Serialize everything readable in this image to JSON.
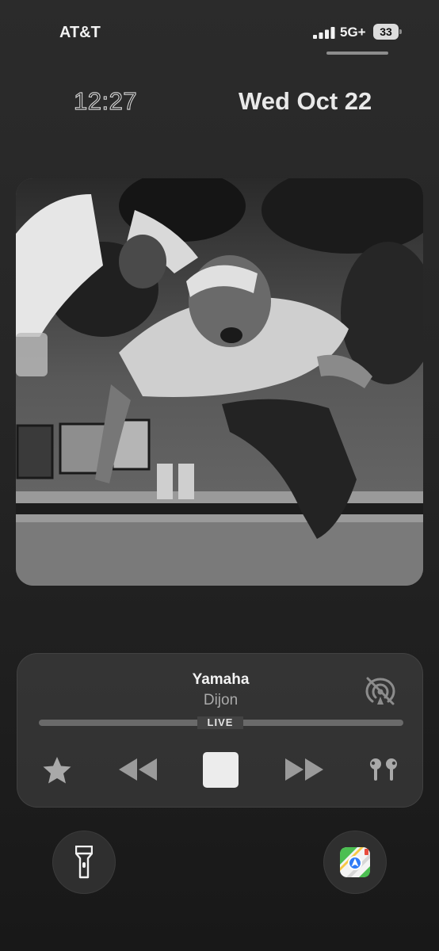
{
  "status_bar": {
    "carrier": "AT&T",
    "network": "5G+",
    "battery_level": "33",
    "icons": [
      "signal-bars-icon",
      "battery-icon"
    ]
  },
  "lock_screen": {
    "time": "12:27",
    "date": "Wed Oct 22"
  },
  "now_playing": {
    "artwork": "album-artwork-bw-party-photo",
    "title": "Yamaha",
    "artist": "Dijon",
    "progress_label": "LIVE",
    "controls": [
      "star-icon",
      "rewind-icon",
      "stop-icon",
      "fast-forward-icon",
      "airpods-icon"
    ],
    "airplay_state_icon": "airplay-off-icon"
  },
  "shortcuts": {
    "left": "flashlight-icon",
    "right": "maps-icon"
  },
  "colors": {
    "background": "#262626",
    "player_card": "#464646",
    "text_primary": "#f2f2f2",
    "text_secondary": "#a9a9a9",
    "maps_green": "#4cbf52",
    "maps_blue": "#2f7bf6"
  }
}
